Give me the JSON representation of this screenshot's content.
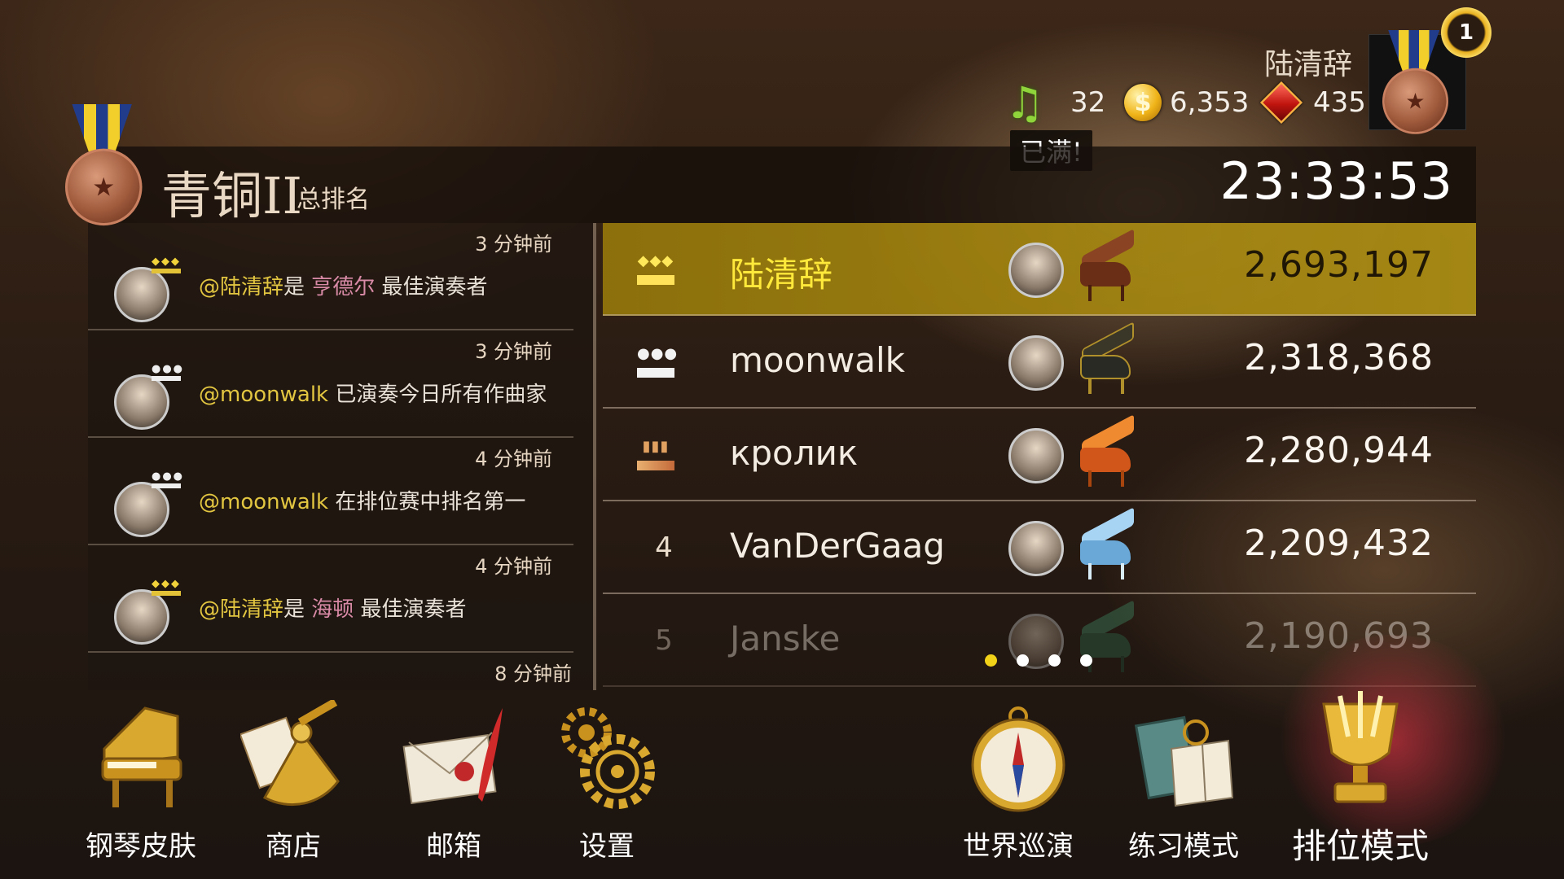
{
  "player": {
    "name": "陆清辞",
    "notes": "32",
    "notes_status": "已满!",
    "coins": "6,353",
    "gems": "435",
    "rank_badge": "1"
  },
  "header": {
    "tier": "青铜II",
    "label": "总排名",
    "timer": "23:33:53"
  },
  "feed": {
    "items": [
      {
        "time": "3 分钟前",
        "mention": "@陆清辞",
        "pre": "是 ",
        "composer": "亨德尔",
        "post": " 最佳演奏者",
        "crown": "gold"
      },
      {
        "time": "3 分钟前",
        "mention": "@moonwalk",
        "pre": " 已演奏今日所有作曲家",
        "composer": "",
        "post": "",
        "crown": "silver"
      },
      {
        "time": "4 分钟前",
        "mention": "@moonwalk",
        "pre": " 在排位赛中排名第一",
        "composer": "",
        "post": "",
        "crown": "silver"
      },
      {
        "time": "4 分钟前",
        "mention": "@陆清辞",
        "pre": "是 ",
        "composer": "海顿",
        "post": " 最佳演奏者",
        "crown": "gold"
      }
    ],
    "last_time": "8 分钟前"
  },
  "leaderboard": {
    "rows": [
      {
        "rank": "",
        "medal": "gold",
        "name": "陆清辞",
        "score": "2,693,197",
        "piano_color": "#7a3a1e"
      },
      {
        "rank": "",
        "medal": "silver",
        "name": "moonwalk",
        "score": "2,318,368",
        "piano_color": "#2a2a24"
      },
      {
        "rank": "",
        "medal": "bronze",
        "name": "кролик",
        "score": "2,280,944",
        "piano_color": "#e06a20"
      },
      {
        "rank": "4",
        "medal": "",
        "name": "VanDerGaag",
        "score": "2,209,432",
        "piano_color": "#7ab6e6"
      },
      {
        "rank": "5",
        "medal": "",
        "name": "Janske",
        "score": "2,190,693",
        "piano_color": "#2e6a4c"
      }
    ],
    "pager": {
      "pages": 4,
      "current": 1
    }
  },
  "nav": {
    "piano_skin": "钢琴皮肤",
    "shop": "商店",
    "mailbox": "邮箱",
    "settings": "设置",
    "world_tour": "世界巡演",
    "practice": "练习模式",
    "ranked": "排位模式"
  },
  "icons": [
    "music-note-icon",
    "coin-icon",
    "ruby-icon",
    "bronze-medal-icon",
    "crown-icon",
    "piano-icon",
    "sextant-icon",
    "letter-icon",
    "gears-icon",
    "compass-icon",
    "book-icon",
    "trophy-icon"
  ]
}
